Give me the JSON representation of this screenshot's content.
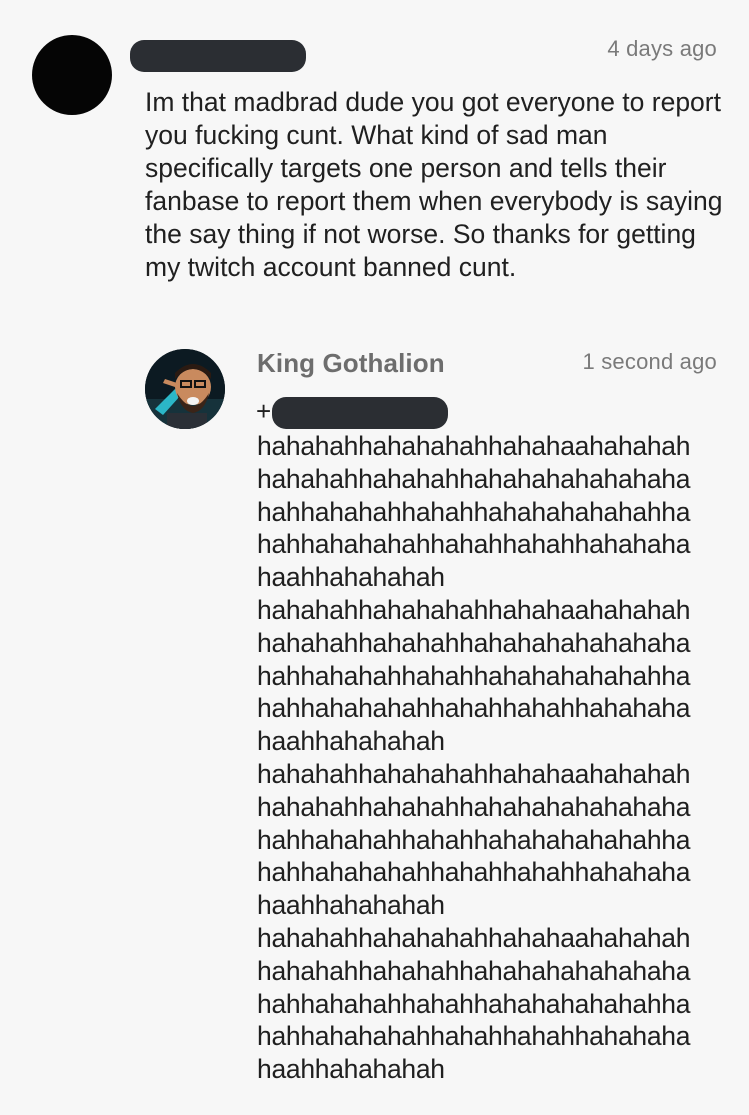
{
  "comment": {
    "timestamp": "4 days ago",
    "body": "Im that madbrad dude you got everyone to report you fucking cunt. What kind of sad man specifically targets one person and tells their fanbase to report them when everybody is saying the say thing if not worse. So thanks for getting my twitch account banned cunt."
  },
  "reply": {
    "author": "King Gothalion",
    "timestamp": "1 second ago",
    "mention_prefix": "+",
    "lines": [
      "hahahahhahahahahhahahaahahahah",
      "hahahahhahahahhahahahahahahaha",
      "hahhahahahhahahhahahahahahahha",
      "hahhahahahahhahahhahahhahahaha",
      "haahhahahahah",
      "hahahahhahahahahhahahaahahahah",
      "hahahahhahahahhahahahahahahaha",
      "hahhahahahhahahhahahahahahahha",
      "hahhahahahahhahahhahahhahahaha",
      "haahhahahahah",
      "hahahahhahahahahhahahaahahahah",
      "hahahahhahahahhahahahahahahaha",
      "hahhahahahhahahhahahahahahahha",
      "hahhahahahahhahahhahahhahahaha",
      "haahhahahahah",
      "hahahahhahahahahhahahaahahahah",
      "hahahahhahahahhahahahahahahaha",
      "hahhahahahhahahhahahahahahahha",
      "hahhahahahahhahahhahahhahahaha",
      "haahhahahahah"
    ]
  }
}
